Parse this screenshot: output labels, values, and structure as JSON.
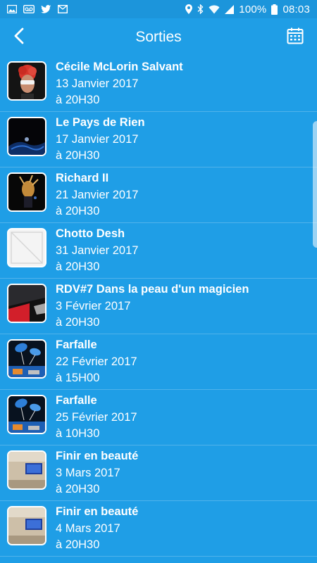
{
  "status_bar": {
    "battery": "100%",
    "time": "08:03",
    "icons": [
      "gallery-icon",
      "voicemail-icon",
      "twitter-icon",
      "mail-icon",
      "location-icon",
      "bluetooth-icon",
      "wifi-icon",
      "signal-icon",
      "battery-icon"
    ]
  },
  "header": {
    "title": "Sorties",
    "back_icon": "back-chevron-icon",
    "calendar_icon": "calendar-icon"
  },
  "events": [
    {
      "title": "Cécile McLorin Salvant",
      "date": "13 Janvier 2017",
      "time": "à 20H30",
      "thumb": "portrait-red-hair"
    },
    {
      "title": "Le Pays de Rien",
      "date": "17 Janvier 2017",
      "time": "à 20H30",
      "thumb": "dark-stage-blue"
    },
    {
      "title": "Richard II",
      "date": "21 Janvier 2017",
      "time": "à 20H30",
      "thumb": "dark-stage-figure"
    },
    {
      "title": "Chotto Desh",
      "date": "31 Janvier 2017",
      "time": "à 20H30",
      "thumb": "placeholder-image"
    },
    {
      "title": "RDV#7 Dans la peau d'un magicien",
      "date": "3 Février 2017",
      "time": "à 20H30",
      "thumb": "red-black-graphic"
    },
    {
      "title": "Farfalle",
      "date": "22 Février 2017",
      "time": "à 15H00",
      "thumb": "kites-blue"
    },
    {
      "title": "Farfalle",
      "date": "25 Février 2017",
      "time": "à 10H30",
      "thumb": "kites-blue"
    },
    {
      "title": "Finir en beauté",
      "date": "3 Mars 2017",
      "time": "à 20H30",
      "thumb": "room-screen"
    },
    {
      "title": "Finir en beauté",
      "date": "4 Mars 2017",
      "time": "à 20H30",
      "thumb": "room-screen"
    }
  ],
  "colors": {
    "background": "#1f9ee6",
    "status_bar": "#1c95db",
    "text": "#ffffff"
  }
}
